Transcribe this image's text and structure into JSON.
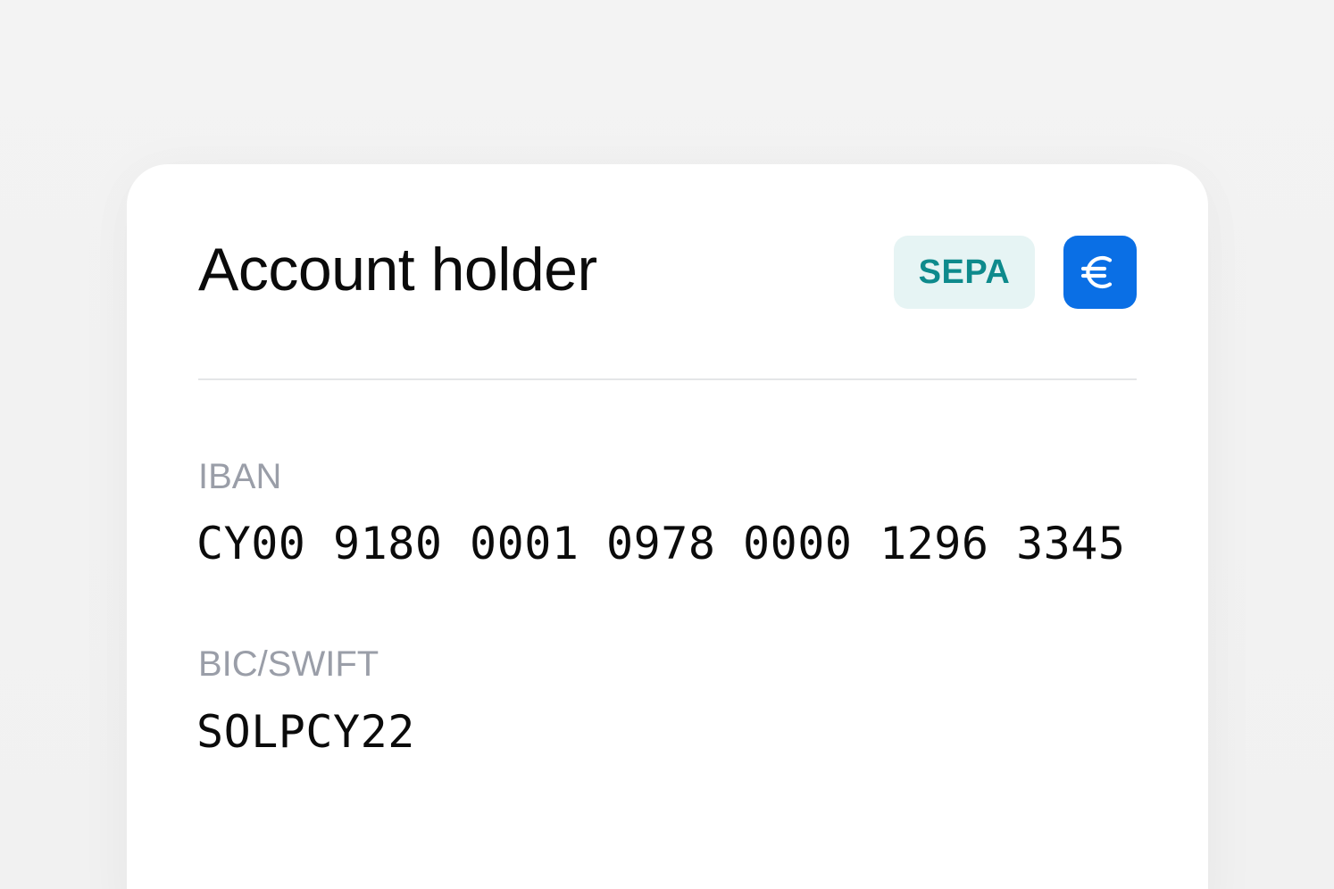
{
  "card": {
    "title": "Account holder",
    "badge": "SEPA",
    "currency_icon": "euro-icon",
    "colors": {
      "badge_bg": "#e6f4f4",
      "badge_text": "#0e8a8c",
      "icon_bg": "#0a6fe5"
    }
  },
  "fields": {
    "iban_label": "IBAN",
    "iban_value": "CY00 9180 0001 0978 0000 1296 3345",
    "bic_label": "BIC/SWIFT",
    "bic_value": "SOLPCY22"
  }
}
